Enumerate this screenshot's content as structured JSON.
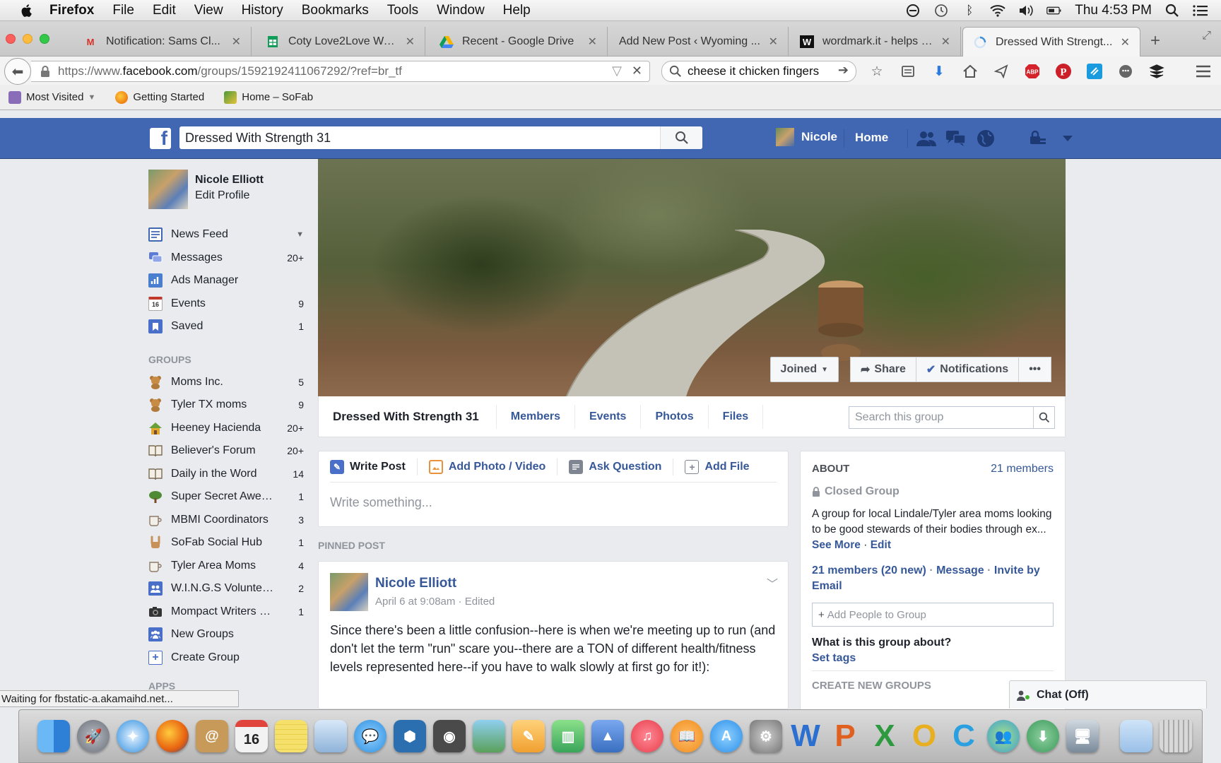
{
  "menubar": {
    "app_name": "Firefox",
    "items": [
      "File",
      "Edit",
      "View",
      "History",
      "Bookmarks",
      "Tools",
      "Window",
      "Help"
    ],
    "clock": "Thu 4:53 PM"
  },
  "tabs": [
    {
      "title": "Notification: Sams Cl...",
      "icon": "gmail-icon",
      "icon_color": "#d93025"
    },
    {
      "title": "Coty Love2Love Walm...",
      "icon": "sheets-icon",
      "icon_color": "#0f9d58"
    },
    {
      "title": "Recent - Google Drive",
      "icon": "drive-icon",
      "icon_color": "#f4b400"
    },
    {
      "title": "Add New Post ‹ Wyoming ...",
      "icon": "wordpress-icon",
      "icon_color": "#777777"
    },
    {
      "title": "wordmark.it - helps y...",
      "icon": "wordmark-icon",
      "icon_color": "#111111"
    },
    {
      "title": "Dressed With Strengt...",
      "icon": "loading-icon",
      "icon_color": "#3b8fd8"
    }
  ],
  "navbar": {
    "url_prefix": "https://www.",
    "url_host": "facebook.com",
    "url_path": "/groups/1592192411067292/?ref=br_tf",
    "search_value": "cheese it chicken fingers"
  },
  "bookmarks": [
    {
      "label": "Most Visited",
      "icon": "most-visited-icon",
      "color": "#8a6db8"
    },
    {
      "label": "Getting Started",
      "icon": "firefox-icon",
      "color": "#e66000"
    },
    {
      "label": "Home – SoFab",
      "icon": "sofab-icon",
      "color": "#4a9a3a"
    }
  ],
  "fb": {
    "search_value": "Dressed With Strength 31",
    "user_name": "Nicole",
    "home_label": "Home",
    "logo_letter": "f"
  },
  "leftnav": {
    "profile_name": "Nicole Elliott",
    "edit_profile": "Edit Profile",
    "main": [
      {
        "label": "News Feed",
        "count": "",
        "icon": "news-feed-icon",
        "color": "#4267b2"
      },
      {
        "label": "Messages",
        "count": "20+",
        "icon": "messages-icon",
        "color": "#5b7bd5"
      },
      {
        "label": "Ads Manager",
        "count": "",
        "icon": "ads-manager-icon",
        "color": "#4a7fd0"
      },
      {
        "label": "Events",
        "count": "9",
        "icon": "events-icon",
        "color": "#c0392b"
      },
      {
        "label": "Saved",
        "count": "1",
        "icon": "saved-icon",
        "color": "#4a6fc9"
      }
    ],
    "groups_title": "GROUPS",
    "groups": [
      {
        "label": "Moms Inc.",
        "count": "5",
        "icon": "teddy-bear-icon",
        "color": "#b07a3a"
      },
      {
        "label": "Tyler TX moms",
        "count": "9",
        "icon": "teddy-bear-icon",
        "color": "#b07a3a"
      },
      {
        "label": "Heeney Hacienda",
        "count": "20+",
        "icon": "house-icon",
        "color": "#e0a82e"
      },
      {
        "label": "Believer's Forum",
        "count": "20+",
        "icon": "book-icon",
        "color": "#7a6a55"
      },
      {
        "label": "Daily in the Word",
        "count": "14",
        "icon": "book-icon",
        "color": "#7a6a55"
      },
      {
        "label": "Super Secret Awes...",
        "count": "1",
        "icon": "tree-icon",
        "color": "#4f8a34"
      },
      {
        "label": "MBMI Coordinators",
        "count": "3",
        "icon": "coffee-cup-icon",
        "color": "#8d7b68"
      },
      {
        "label": "SoFab Social Hub",
        "count": "1",
        "icon": "rock-hand-icon",
        "color": "#c9915a"
      },
      {
        "label": "Tyler Area Moms",
        "count": "4",
        "icon": "coffee-cup-icon",
        "color": "#8d7b68"
      },
      {
        "label": "W.I.N.G.S Volunteers",
        "count": "2",
        "icon": "group-icon",
        "color": "#4a6fc9"
      },
      {
        "label": "Mompact Writers an...",
        "count": "1",
        "icon": "camera-icon",
        "color": "#333333"
      },
      {
        "label": "New Groups",
        "count": "",
        "icon": "new-groups-icon",
        "color": "#4a6fc9"
      },
      {
        "label": "Create Group",
        "count": "",
        "icon": "create-group-icon",
        "color": "#4a6fc9"
      }
    ],
    "apps_title": "APPS"
  },
  "cover": {
    "joined": "Joined",
    "share": "Share",
    "notifications": "Notifications",
    "more": "•••"
  },
  "group_nav": {
    "name": "Dressed With Strength 31",
    "tabs": [
      "Members",
      "Events",
      "Photos",
      "Files"
    ],
    "search_placeholder": "Search this group"
  },
  "composer": {
    "tabs": [
      "Write Post",
      "Add Photo / Video",
      "Ask Question",
      "Add File"
    ],
    "placeholder": "Write something..."
  },
  "pinned": {
    "label": "PINNED POST",
    "author": "Nicole Elliott",
    "meta": "April 6 at 9:08am · Edited",
    "body": "Since there's been a little confusion--here is when we're meeting up to run (and don't let the term \"run\" scare you--there are a TON of different health/fitness levels represented here--if you have to walk slowly at first go for it!):"
  },
  "about": {
    "title": "ABOUT",
    "members_count": "21 members",
    "privacy": "Closed Group",
    "description": "A group for local Lindale/Tyler area moms looking to be good stewards of their bodies through ex...",
    "see_more": "See More",
    "edit": "Edit",
    "members_line": "21 members",
    "new_count": "(20 new)",
    "message": "Message",
    "invite": "Invite by Email",
    "add_people_placeholder": "Add People to Group",
    "question": "What is this group about?",
    "set_tags": "Set tags",
    "create_new": "CREATE NEW GROUPS"
  },
  "chat_label": "Chat (Off)",
  "status_text": "Waiting for fbstatic-a.akamaihd.net...",
  "dock": [
    {
      "name": "finder-icon",
      "color": "#3d8fe0"
    },
    {
      "name": "launchpad-icon",
      "color": "#7a7f88"
    },
    {
      "name": "safari-icon",
      "color": "#2f8fe0"
    },
    {
      "name": "firefox-icon",
      "color": "#e8620f"
    },
    {
      "name": "contacts-icon",
      "color": "#c89a5a"
    },
    {
      "name": "calendar-icon",
      "color": "#f2f2f2",
      "text": "16"
    },
    {
      "name": "notes-icon",
      "color": "#f5e06b"
    },
    {
      "name": "preview-icon",
      "color": "#8fb3d9"
    },
    {
      "name": "messages-icon",
      "color": "#4fa3f0"
    },
    {
      "name": "vpn-icon",
      "color": "#2c6fb0"
    },
    {
      "name": "facetime-icon",
      "color": "#4a4a4a"
    },
    {
      "name": "iphoto-icon",
      "color": "#5aa05a"
    },
    {
      "name": "pages-icon",
      "color": "#f0a030"
    },
    {
      "name": "numbers-icon",
      "color": "#3aa55a"
    },
    {
      "name": "keynote-icon",
      "color": "#3a6fc0"
    },
    {
      "name": "itunes-icon",
      "color": "#e83c4a"
    },
    {
      "name": "ibooks-icon",
      "color": "#f08a1a"
    },
    {
      "name": "app-store-icon",
      "color": "#2a8fe8"
    },
    {
      "name": "system-preferences-icon",
      "color": "#777777"
    },
    {
      "name": "word-icon",
      "color": "#2b6fd0",
      "text": "W"
    },
    {
      "name": "powerpoint-icon",
      "color": "#e06020",
      "text": "P"
    },
    {
      "name": "excel-icon",
      "color": "#2e9a40",
      "text": "X"
    },
    {
      "name": "outlook-icon",
      "color": "#e8b020",
      "text": "O"
    },
    {
      "name": "lync-icon",
      "color": "#2aa0e0",
      "text": "C"
    },
    {
      "name": "messenger-icon",
      "color": "#3aa0d0"
    },
    {
      "name": "download-icon",
      "color": "#3a9a5a"
    },
    {
      "name": "remote-desktop-icon",
      "color": "#7a8a9a"
    },
    {
      "name": "documents-folder-icon",
      "color": "#9ac0e8"
    },
    {
      "name": "trash-icon",
      "color": "#b0b0b0"
    }
  ]
}
